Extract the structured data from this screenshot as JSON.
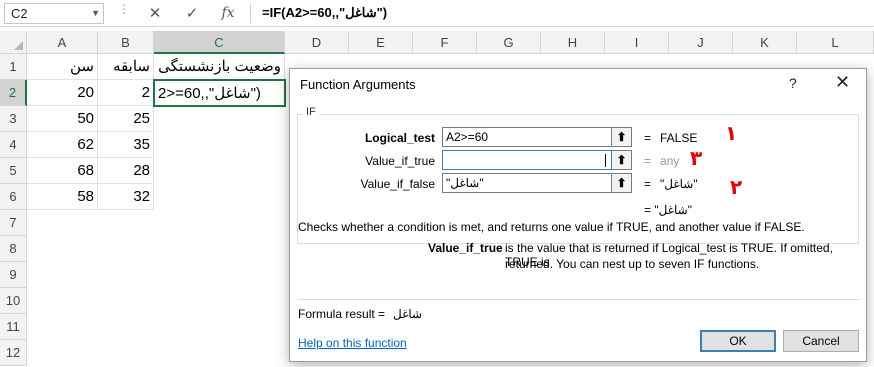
{
  "formula_bar": {
    "name_box": "C2",
    "cancel_icon": "✕",
    "enter_icon": "✓",
    "fx_label": "fx",
    "formula": "=IF(A2>=60,,\"شاغل\")"
  },
  "sheet": {
    "columns": [
      "A",
      "B",
      "C",
      "D",
      "E",
      "F",
      "G",
      "H",
      "I",
      "J",
      "K",
      "L"
    ],
    "rows": [
      "1",
      "2",
      "3",
      "4",
      "5",
      "6",
      "7",
      "8",
      "9",
      "10",
      "11",
      "12"
    ],
    "header_row": {
      "A": "سن",
      "B": "سابقه",
      "C": "وضعیت بازنشستگی"
    },
    "data": [
      {
        "A": "20",
        "B": "2",
        "C": "2>=60,,\"شاغل\")"
      },
      {
        "A": "50",
        "B": "25",
        "C": ""
      },
      {
        "A": "62",
        "B": "35",
        "C": ""
      },
      {
        "A": "68",
        "B": "28",
        "C": ""
      },
      {
        "A": "58",
        "B": "32",
        "C": ""
      }
    ]
  },
  "dialog": {
    "title": "Function Arguments",
    "help_glyph": "?",
    "close_glyph": "✕",
    "function_name": "IF",
    "args": [
      {
        "label": "Logical_test",
        "value": "A2>=60",
        "result": "FALSE"
      },
      {
        "label": "Value_if_true",
        "value": "",
        "result": "any"
      },
      {
        "label": "Value_if_false",
        "value": "\"شاغل\"",
        "result": "\"شاغل\""
      }
    ],
    "overall_result": "= \"شاغل\"",
    "description": "Checks whether a condition is met, and returns one value if TRUE, and another value if FALSE.",
    "arg_help_name": "Value_if_true",
    "arg_help_text_1": "is the value that is returned if Logical_test is TRUE. If omitted, TRUE is",
    "arg_help_text_2": "returned. You can nest up to seven IF functions.",
    "formula_result_label": "Formula result =",
    "formula_result_value": "شاغل",
    "help_link": "Help on this function",
    "ok_label": "OK",
    "cancel_label": "Cancel",
    "ref_btn_glyph": "⬆",
    "eq_sign": "="
  },
  "annotations": [
    "۱",
    "۳",
    "۲"
  ]
}
